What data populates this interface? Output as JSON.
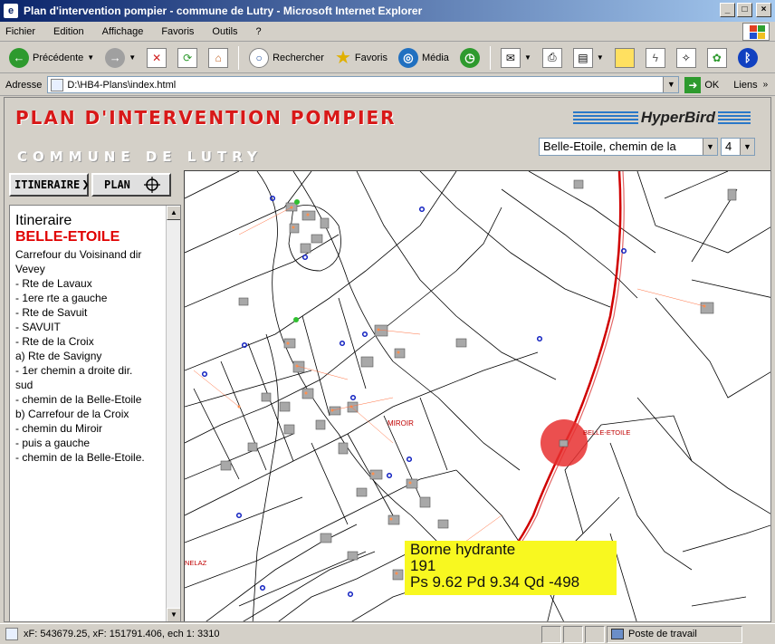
{
  "window": {
    "title": "Plan d'intervention pompier - commune de Lutry - Microsoft Internet Explorer",
    "controls": [
      "_",
      "□",
      "×"
    ]
  },
  "menu": [
    "Fichier",
    "Edition",
    "Affichage",
    "Favoris",
    "Outils",
    "?"
  ],
  "toolbar": {
    "back_label": "Précédente",
    "search_label": "Rechercher",
    "favorites_label": "Favoris",
    "media_label": "Média"
  },
  "address": {
    "label": "Adresse",
    "value": "D:\\HB4-Plans\\index.html",
    "go_label": "OK",
    "links_label": "Liens"
  },
  "page": {
    "title": "PLAN D'INTERVENTION POMPIER",
    "subtitle": "COMMUNE DE LUTRY",
    "brand": "HyperBird",
    "street_select": "Belle-Etoile, chemin de la",
    "number_select": "4",
    "itinerary_button": "ITINERAIRE",
    "plan_button": "PLAN"
  },
  "itinerary": {
    "heading": "Itineraire",
    "place": "BELLE-ETOILE",
    "lines": [
      "Carrefour du Voisinand dir",
      "Vevey",
      "- Rte de Lavaux",
      "- 1ere rte a gauche",
      "- Rte de Savuit",
      "- SAVUIT",
      "- Rte de la Croix",
      "a) Rte de Savigny",
      "- 1er chemin a droite dir.",
      "sud",
      "- chemin de la Belle-Etoile",
      "b) Carrefour de la Croix",
      "- chemin du Miroir",
      "- puis a gauche",
      "- chemin de la Belle-Etoile."
    ]
  },
  "map": {
    "labels": {
      "miroir": "MIROIR",
      "belle_etoile": "BELLE-ETOILE",
      "nelaz": "NELAZ"
    },
    "tooltip": {
      "line1": "Borne hydrante",
      "line2": "191",
      "line3": "Ps 9.62 Pd 9.34 Qd -498"
    },
    "colors": {
      "route": "#d00000",
      "hydrant_circle": "#e83030",
      "building": "#a8a8a8",
      "marker_blue": "#1020c0",
      "tooltip_bg": "#f8f820"
    }
  },
  "status": {
    "text": "xF: 543679.25, xF: 151791.406, ech 1: 3310",
    "zone": "Poste de travail"
  }
}
